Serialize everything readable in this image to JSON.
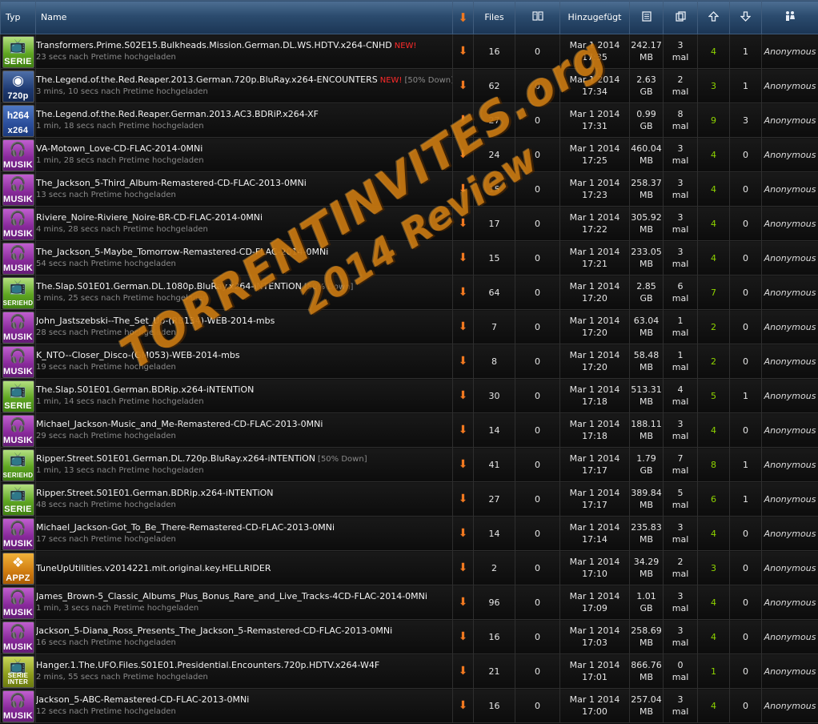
{
  "header": {
    "typ": "Typ",
    "name": "Name",
    "files": "Files",
    "hinzugefuegt": "Hinzugefügt",
    "icons": {
      "download": "download-arrow-icon",
      "comments": "comments-icon",
      "size": "size-icon",
      "snatched": "snatched-icon",
      "seeders": "seeders-up-icon",
      "leechers": "leechers-down-icon",
      "uploader": "users-icon"
    }
  },
  "rows": [
    {
      "cat": "serie",
      "badge": "SERIE",
      "name": "Transformers.Prime.S02E15.Bulkheads.Mission.German.DL.WS.HDTV.x264-CNHD",
      "new": "NEW!",
      "down": "",
      "sub": "23 secs nach Pretime hochgeladen",
      "files": "16",
      "comments": "0",
      "date": "Mar 1 2014",
      "time": "17:35",
      "size": "242.17",
      "unit": "MB",
      "snatched": "3",
      "mal": "mal",
      "seeders": "4",
      "leechers": "1",
      "uploader": "Anonymous"
    },
    {
      "cat": "720p",
      "badge": "720p",
      "name": "The.Legend.of.the.Red.Reaper.2013.German.720p.BluRay.x264-ENCOUNTERS",
      "new": "NEW!",
      "down": "[50% Down]",
      "sub": "3 mins, 10 secs nach Pretime hochgeladen",
      "files": "62",
      "comments": "0",
      "date": "Mar 1 2014",
      "time": "17:34",
      "size": "2.63",
      "unit": "GB",
      "snatched": "2",
      "mal": "mal",
      "seeders": "3",
      "leechers": "1",
      "uploader": "Anonymous"
    },
    {
      "cat": "x264",
      "badge": "x264",
      "name": "The.Legend.of.the.Red.Reaper.German.2013.AC3.BDRiP.x264-XF",
      "new": "",
      "down": "",
      "sub": "1 min, 18 secs nach Pretime hochgeladen",
      "files": "27",
      "comments": "0",
      "date": "Mar 1 2014",
      "time": "17:31",
      "size": "0.99",
      "unit": "GB",
      "snatched": "8",
      "mal": "mal",
      "seeders": "9",
      "leechers": "3",
      "uploader": "Anonymous"
    },
    {
      "cat": "musik",
      "badge": "MUSIK",
      "name": "VA-Motown_Love-CD-FLAC-2014-0MNi",
      "new": "",
      "down": "",
      "sub": "1 min, 28 secs nach Pretime hochgeladen",
      "files": "24",
      "comments": "0",
      "date": "Mar 1 2014",
      "time": "17:25",
      "size": "460.04",
      "unit": "MB",
      "snatched": "3",
      "mal": "mal",
      "seeders": "4",
      "leechers": "0",
      "uploader": "Anonymous"
    },
    {
      "cat": "musik",
      "badge": "MUSIK",
      "name": "The_Jackson_5-Third_Album-Remastered-CD-FLAC-2013-0MNi",
      "new": "",
      "down": "",
      "sub": "13 secs nach Pretime hochgeladen",
      "files": "15",
      "comments": "0",
      "date": "Mar 1 2014",
      "time": "17:23",
      "size": "258.37",
      "unit": "MB",
      "snatched": "3",
      "mal": "mal",
      "seeders": "4",
      "leechers": "0",
      "uploader": "Anonymous"
    },
    {
      "cat": "musik",
      "badge": "MUSIK",
      "name": "Riviere_Noire-Riviere_Noire-BR-CD-FLAC-2014-0MNi",
      "new": "",
      "down": "",
      "sub": "4 mins, 28 secs nach Pretime hochgeladen",
      "files": "17",
      "comments": "0",
      "date": "Mar 1 2014",
      "time": "17:22",
      "size": "305.92",
      "unit": "MB",
      "snatched": "3",
      "mal": "mal",
      "seeders": "4",
      "leechers": "0",
      "uploader": "Anonymous"
    },
    {
      "cat": "musik",
      "badge": "MUSIK",
      "name": "The_Jackson_5-Maybe_Tomorrow-Remastered-CD-FLAC-2014-0MNi",
      "new": "",
      "down": "",
      "sub": "54 secs nach Pretime hochgeladen",
      "files": "15",
      "comments": "0",
      "date": "Mar 1 2014",
      "time": "17:21",
      "size": "233.05",
      "unit": "MB",
      "snatched": "3",
      "mal": "mal",
      "seeders": "4",
      "leechers": "0",
      "uploader": "Anonymous"
    },
    {
      "cat": "seriehd",
      "badge": "SERIEHD",
      "name": "The.Slap.S01E01.German.DL.1080p.BluRay.x264-iNTENTiON",
      "new": "",
      "down": "[50% Down]",
      "sub": "3 mins, 25 secs nach Pretime hochgeladen",
      "files": "64",
      "comments": "0",
      "date": "Mar 1 2014",
      "time": "17:20",
      "size": "2.85",
      "unit": "GB",
      "snatched": "6",
      "mal": "mal",
      "seeders": "7",
      "leechers": "0",
      "uploader": "Anonymous"
    },
    {
      "cat": "musik",
      "badge": "MUSIK",
      "name": "John_Jastszebski--The_Set_Up-(RB134)-WEB-2014-mbs",
      "new": "",
      "down": "",
      "sub": "28 secs nach Pretime hochgeladen",
      "files": "7",
      "comments": "0",
      "date": "Mar 1 2014",
      "time": "17:20",
      "size": "63.04",
      "unit": "MB",
      "snatched": "1",
      "mal": "mal",
      "seeders": "2",
      "leechers": "0",
      "uploader": "Anonymous"
    },
    {
      "cat": "musik",
      "badge": "MUSIK",
      "name": "K_NTO--Closer_Disco-(GM053)-WEB-2014-mbs",
      "new": "",
      "down": "",
      "sub": "19 secs nach Pretime hochgeladen",
      "files": "8",
      "comments": "0",
      "date": "Mar 1 2014",
      "time": "17:20",
      "size": "58.48",
      "unit": "MB",
      "snatched": "1",
      "mal": "mal",
      "seeders": "2",
      "leechers": "0",
      "uploader": "Anonymous"
    },
    {
      "cat": "serie",
      "badge": "SERIE",
      "name": "The.Slap.S01E01.German.BDRip.x264-iNTENTiON",
      "new": "",
      "down": "",
      "sub": "1 min, 14 secs nach Pretime hochgeladen",
      "files": "30",
      "comments": "0",
      "date": "Mar 1 2014",
      "time": "17:18",
      "size": "513.31",
      "unit": "MB",
      "snatched": "4",
      "mal": "mal",
      "seeders": "5",
      "leechers": "1",
      "uploader": "Anonymous"
    },
    {
      "cat": "musik",
      "badge": "MUSIK",
      "name": "Michael_Jackson-Music_and_Me-Remastered-CD-FLAC-2013-0MNi",
      "new": "",
      "down": "",
      "sub": "29 secs nach Pretime hochgeladen",
      "files": "14",
      "comments": "0",
      "date": "Mar 1 2014",
      "time": "17:18",
      "size": "188.11",
      "unit": "MB",
      "snatched": "3",
      "mal": "mal",
      "seeders": "4",
      "leechers": "0",
      "uploader": "Anonymous"
    },
    {
      "cat": "seriehd",
      "badge": "SERIEHD",
      "name": "Ripper.Street.S01E01.German.DL.720p.BluRay.x264-iNTENTiON",
      "new": "",
      "down": "[50% Down]",
      "sub": "1 min, 13 secs nach Pretime hochgeladen",
      "files": "41",
      "comments": "0",
      "date": "Mar 1 2014",
      "time": "17:17",
      "size": "1.79",
      "unit": "GB",
      "snatched": "7",
      "mal": "mal",
      "seeders": "8",
      "leechers": "1",
      "uploader": "Anonymous"
    },
    {
      "cat": "serie",
      "badge": "SERIE",
      "name": "Ripper.Street.S01E01.German.BDRip.x264-iNTENTiON",
      "new": "",
      "down": "",
      "sub": "48 secs nach Pretime hochgeladen",
      "files": "27",
      "comments": "0",
      "date": "Mar 1 2014",
      "time": "17:17",
      "size": "389.84",
      "unit": "MB",
      "snatched": "5",
      "mal": "mal",
      "seeders": "6",
      "leechers": "1",
      "uploader": "Anonymous"
    },
    {
      "cat": "musik",
      "badge": "MUSIK",
      "name": "Michael_Jackson-Got_To_Be_There-Remastered-CD-FLAC-2013-0MNi",
      "new": "",
      "down": "",
      "sub": "17 secs nach Pretime hochgeladen",
      "files": "14",
      "comments": "0",
      "date": "Mar 1 2014",
      "time": "17:14",
      "size": "235.83",
      "unit": "MB",
      "snatched": "3",
      "mal": "mal",
      "seeders": "4",
      "leechers": "0",
      "uploader": "Anonymous"
    },
    {
      "cat": "appz",
      "badge": "APPZ",
      "name": "TuneUpUtilities.v2014221.mit.original.key.HELLRIDER",
      "new": "",
      "down": "",
      "sub": "",
      "files": "2",
      "comments": "0",
      "date": "Mar 1 2014",
      "time": "17:10",
      "size": "34.29",
      "unit": "MB",
      "snatched": "2",
      "mal": "mal",
      "seeders": "3",
      "leechers": "0",
      "uploader": "Anonymous"
    },
    {
      "cat": "musik",
      "badge": "MUSIK",
      "name": "James_Brown-5_Classic_Albums_Plus_Bonus_Rare_and_Live_Tracks-4CD-FLAC-2014-0MNi",
      "new": "",
      "down": "",
      "sub": "1 min, 3 secs nach Pretime hochgeladen",
      "files": "96",
      "comments": "0",
      "date": "Mar 1 2014",
      "time": "17:09",
      "size": "1.01",
      "unit": "GB",
      "snatched": "3",
      "mal": "mal",
      "seeders": "4",
      "leechers": "0",
      "uploader": "Anonymous"
    },
    {
      "cat": "musik",
      "badge": "MUSIK",
      "name": "Jackson_5-Diana_Ross_Presents_The_Jackson_5-Remastered-CD-FLAC-2013-0MNi",
      "new": "",
      "down": "",
      "sub": "16 secs nach Pretime hochgeladen",
      "files": "16",
      "comments": "0",
      "date": "Mar 1 2014",
      "time": "17:03",
      "size": "258.69",
      "unit": "MB",
      "snatched": "3",
      "mal": "mal",
      "seeders": "4",
      "leechers": "0",
      "uploader": "Anonymous"
    },
    {
      "cat": "inter",
      "badge": "SERIE INTER",
      "name": "Hanger.1.The.UFO.Files.S01E01.Presidential.Encounters.720p.HDTV.x264-W4F",
      "new": "",
      "down": "",
      "sub": "2 mins, 55 secs nach Pretime hochgeladen",
      "files": "21",
      "comments": "0",
      "date": "Mar 1 2014",
      "time": "17:01",
      "size": "866.76",
      "unit": "MB",
      "snatched": "0",
      "mal": "mal",
      "seeders": "1",
      "leechers": "0",
      "uploader": "Anonymous"
    },
    {
      "cat": "musik",
      "badge": "MUSIK",
      "name": "Jackson_5-ABC-Remastered-CD-FLAC-2013-0MNi",
      "new": "",
      "down": "",
      "sub": "12 secs nach Pretime hochgeladen",
      "files": "16",
      "comments": "0",
      "date": "Mar 1 2014",
      "time": "17:00",
      "size": "257.04",
      "unit": "MB",
      "snatched": "3",
      "mal": "mal",
      "seeders": "4",
      "leechers": "0",
      "uploader": "Anonymous"
    }
  ],
  "watermark": {
    "line1": "TORRENTINVITES.org",
    "line2": "2014 Review"
  },
  "colors": {
    "header_top": "#4d6f93",
    "header_bottom": "#1b3554",
    "seeders": "#8ed400",
    "download_arrow": "#f07820",
    "new_tag": "#ff2a2a",
    "watermark": "#d68212"
  }
}
